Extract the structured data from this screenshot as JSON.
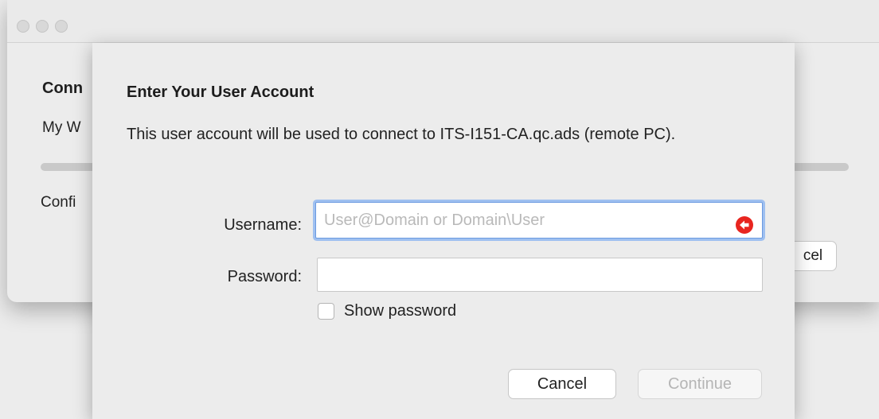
{
  "parent_window": {
    "title": "Conn",
    "subtitle": "My W",
    "status": "Confi",
    "cancel_label": "cel"
  },
  "sheet": {
    "title": "Enter Your User Account",
    "description": "This user account will be used to connect to ITS-I151-CA.qc.ads (remote PC).",
    "username": {
      "label": "Username:",
      "value": "",
      "placeholder": "User@Domain or Domain\\User",
      "alert_icon": "back-arrow-circle-icon",
      "alert_color": "#e8251f"
    },
    "password": {
      "label": "Password:",
      "value": ""
    },
    "show_password": {
      "label": "Show password",
      "checked": false
    },
    "buttons": {
      "cancel": "Cancel",
      "continue": "Continue"
    }
  },
  "colors": {
    "focus_ring": "#9fc0f0",
    "disabled_text": "#b5b5b5"
  }
}
